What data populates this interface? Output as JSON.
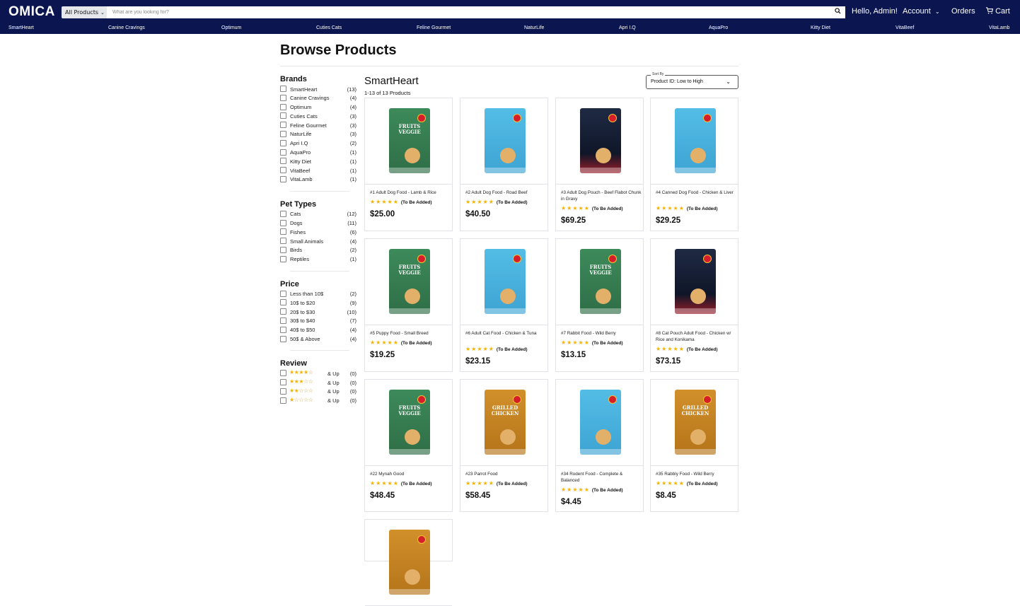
{
  "header": {
    "logo": "OMICA",
    "category_select": "All Products",
    "search_placeholder": "What are you looking for?",
    "greeting": "Hello, Admin!",
    "account": "Account",
    "orders": "Orders",
    "cart": "Cart"
  },
  "brand_nav": [
    "SmartHeart",
    "Canine Cravings",
    "Optimum",
    "Cuties Cats",
    "Feline Gourmet",
    "NaturLife",
    "Apri I.Q",
    "AquaPro",
    "Kitty Diet",
    "VitaBeef",
    "VitaLamb"
  ],
  "main": {
    "title": "Browse Products",
    "brand_heading": "SmartHeart",
    "result_count": "1-13 of 13 Products",
    "sort": {
      "legend": "Sort By",
      "value": "Product ID: Low to High"
    }
  },
  "filters": {
    "brands": {
      "title": "Brands",
      "items": [
        {
          "label": "SmartHeart",
          "count": "(13)"
        },
        {
          "label": "Canine Cravings",
          "count": "(4)"
        },
        {
          "label": "Optimum",
          "count": "(4)"
        },
        {
          "label": "Cuties Cats",
          "count": "(3)"
        },
        {
          "label": "Feline Gourmet",
          "count": "(3)"
        },
        {
          "label": "NaturLife",
          "count": "(3)"
        },
        {
          "label": "Apri I.Q",
          "count": "(2)"
        },
        {
          "label": "AquaPro",
          "count": "(1)"
        },
        {
          "label": "Kitty Diet",
          "count": "(1)"
        },
        {
          "label": "VitaBeef",
          "count": "(1)"
        },
        {
          "label": "VitaLamb",
          "count": "(1)"
        }
      ]
    },
    "pet_types": {
      "title": "Pet Types",
      "items": [
        {
          "label": "Cats",
          "count": "(12)"
        },
        {
          "label": "Dogs",
          "count": "(11)"
        },
        {
          "label": "Fishes",
          "count": "(6)"
        },
        {
          "label": "Small Animals",
          "count": "(4)"
        },
        {
          "label": "Birds",
          "count": "(2)"
        },
        {
          "label": "Reptiles",
          "count": "(1)"
        }
      ]
    },
    "price": {
      "title": "Price",
      "items": [
        {
          "label": "Less than 10$",
          "count": "(2)"
        },
        {
          "label": "10$ to $20",
          "count": "(9)"
        },
        {
          "label": "20$ to $30",
          "count": "(10)"
        },
        {
          "label": "30$ to $40",
          "count": "(7)"
        },
        {
          "label": "40$ to $50",
          "count": "(4)"
        },
        {
          "label": "50$ & Above",
          "count": "(4)"
        }
      ]
    },
    "review": {
      "title": "Review",
      "items": [
        {
          "stars": 4,
          "label": "& Up",
          "count": "(0)"
        },
        {
          "stars": 3,
          "label": "& Up",
          "count": "(0)"
        },
        {
          "stars": 2,
          "label": "& Up",
          "count": "(0)"
        },
        {
          "stars": 1,
          "label": "& Up",
          "count": "(0)"
        }
      ]
    }
  },
  "products": [
    {
      "name": "#1 Adult Dog Food - Lamb & Rice",
      "rating_text": "(To Be Added)",
      "price": "$25.00",
      "package_color": "green",
      "package_text": "FRUITS VEGGIE"
    },
    {
      "name": "#2 Adult Dog Food - Road Beef",
      "rating_text": "(To Be Added)",
      "price": "$40.50",
      "package_color": "blue",
      "package_text": ""
    },
    {
      "name": "#3 Adult Dog Pouch - Beef Flabot Chunk in Gravy",
      "rating_text": "(To Be Added)",
      "price": "$69.25",
      "package_color": "navy",
      "package_text": ""
    },
    {
      "name": "#4 Canned Dog Food - Chicken & Liver",
      "rating_text": "(To Be Added)",
      "price": "$29.25",
      "package_color": "blue",
      "package_text": ""
    },
    {
      "name": "#5 Puppy Food - Small Breed",
      "rating_text": "(To Be Added)",
      "price": "$19.25",
      "package_color": "green",
      "package_text": "FRUITS VEGGIE"
    },
    {
      "name": "#6 Adult Cat Food - Chicken & Tuna",
      "rating_text": "(To Be Added)",
      "price": "$23.15",
      "package_color": "blue",
      "package_text": ""
    },
    {
      "name": "#7 Rabbit Food - Wild Berry",
      "rating_text": "(To Be Added)",
      "price": "$13.15",
      "package_color": "green",
      "package_text": "FRUITS VEGGIE"
    },
    {
      "name": "#8 Cat Pouch Adult Food - Chicken w/ Rice and Konikama",
      "rating_text": "(To Be Added)",
      "price": "$73.15",
      "package_color": "navy",
      "package_text": ""
    },
    {
      "name": "#22 Mynah Good",
      "rating_text": "(To Be Added)",
      "price": "$48.45",
      "package_color": "green",
      "package_text": "FRUITS VEGGIE"
    },
    {
      "name": "#23 Parrot Food",
      "rating_text": "(To Be Added)",
      "price": "$58.45",
      "package_color": "orange",
      "package_text": "GRILLED CHICKEN"
    },
    {
      "name": "#34 Rodent Food - Complete & Balanced",
      "rating_text": "(To Be Added)",
      "price": "$4.45",
      "package_color": "blue",
      "package_text": ""
    },
    {
      "name": "#35 Rabbly Food - Wild Berry",
      "rating_text": "(To Be Added)",
      "price": "$8.45",
      "package_color": "orange",
      "package_text": "GRILLED CHICKEN"
    },
    {
      "name": "",
      "rating_text": "",
      "price": "",
      "package_color": "orange",
      "package_text": ""
    }
  ],
  "colors": {
    "header_bg": "#0b1650",
    "star": "#f5b301",
    "border": "#e1e3e8"
  }
}
